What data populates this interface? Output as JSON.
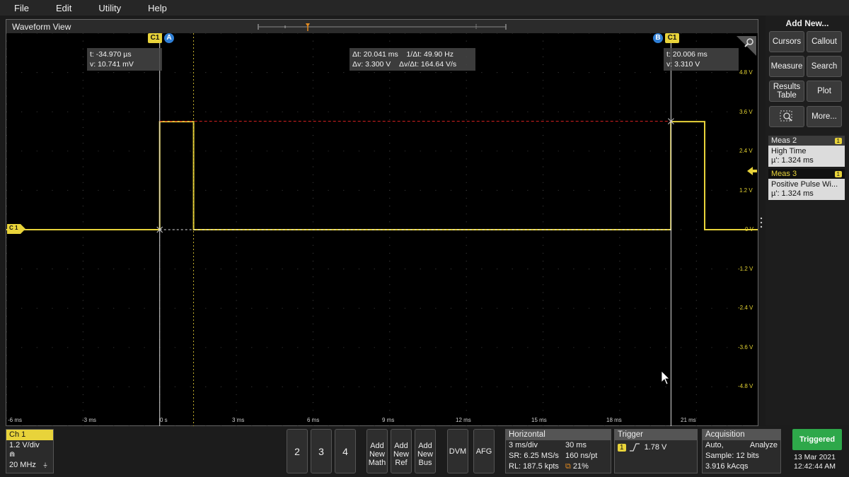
{
  "menu": [
    "File",
    "Edit",
    "Utility",
    "Help"
  ],
  "waveform_view": {
    "title": "Waveform View",
    "channel_badge": "C1",
    "cursor_a_label": "A",
    "cursor_b_label": "B",
    "cursor_a_readout": [
      "t: -34.970 µs",
      "v: 10.741 mV"
    ],
    "cursor_b_readout": [
      "t: 20.006 ms",
      "v: 3.310 V"
    ],
    "delta_readout": {
      "dt": "Δt: 20.041 ms",
      "inv_dt": "1/Δt: 49.90 Hz",
      "dv": "Δv: 3.300 V",
      "dv_dt": "Δv/Δt: 164.64 V/s"
    },
    "ch_marker": "C 1",
    "volt_labels": [
      "4.8 V",
      "3.6 V",
      "2.4 V",
      "1.2 V",
      "0 V",
      "-1.2 V",
      "-2.4 V",
      "-3.6 V",
      "-4.8 V"
    ],
    "time_labels": [
      "-6 ms",
      "-3 ms",
      "0 s",
      "3 ms",
      "6 ms",
      "9 ms",
      "12 ms",
      "15 ms",
      "18 ms",
      "21 ms"
    ],
    "trace_color": "#e8d33a"
  },
  "chart_data": {
    "type": "line",
    "series": [
      {
        "name": "C1",
        "x": [
          -6,
          0,
          0,
          1.324,
          1.324,
          20.0,
          20.0,
          21.324,
          21.324,
          23.4
        ],
        "y": [
          0,
          0,
          3.3,
          3.3,
          0,
          0,
          3.3,
          3.3,
          0,
          0
        ]
      }
    ],
    "xlim": [
      -6,
      23.4
    ],
    "ylim": [
      -6,
      6
    ],
    "xticks": [
      -6,
      -3,
      0,
      3,
      6,
      9,
      12,
      15,
      18,
      21
    ],
    "yticks": [
      4.8,
      3.6,
      2.4,
      1.2,
      0,
      -1.2,
      -2.4,
      -3.6,
      -4.8
    ],
    "cursors": {
      "a_time": 0,
      "b_time": 20.006,
      "a_level": 0,
      "b_level": 3.31
    }
  },
  "right_panel": {
    "add_new": "Add New...",
    "buttons": [
      "Cursors",
      "Callout",
      "Measure",
      "Search",
      "Results Table",
      "Plot",
      "More..."
    ],
    "meas2": {
      "title": "Meas 2",
      "badge": "1",
      "name": "High Time",
      "value": "µ': 1.324 ms"
    },
    "meas3": {
      "title": "Meas 3",
      "badge": "1",
      "name": "Positive Pulse Wi...",
      "value": "µ': 1.324 ms"
    }
  },
  "bottom": {
    "ch1": {
      "title": "Ch 1",
      "scale": "1.2 V/div",
      "bw": "20 MHz"
    },
    "channel_buttons": [
      "2",
      "3",
      "4"
    ],
    "add_buttons": [
      {
        "l1": "Add",
        "l2": "New",
        "l3": "Math"
      },
      {
        "l1": "Add",
        "l2": "New",
        "l3": "Ref"
      },
      {
        "l1": "Add",
        "l2": "New",
        "l3": "Bus"
      }
    ],
    "dvm": "DVM",
    "afg": "AFG",
    "horizontal": {
      "title": "Horizontal",
      "scale": "3 ms/div",
      "pos": "30 ms",
      "sr": "SR: 6.25 MS/s",
      "pt": "160 ns/pt",
      "rl": "RL: 187.5 kpts",
      "pct": "21%"
    },
    "trigger": {
      "title": "Trigger",
      "src": "1",
      "level": "1.78 V"
    },
    "acquisition": {
      "title": "Acquisition",
      "mode": "Auto,",
      "analyze": "Analyze",
      "sample": "Sample: 12 bits",
      "acqs": "3.916 kAcqs"
    },
    "status": "Triggered",
    "date": "13 Mar 2021",
    "time": "12:42:44 AM"
  }
}
